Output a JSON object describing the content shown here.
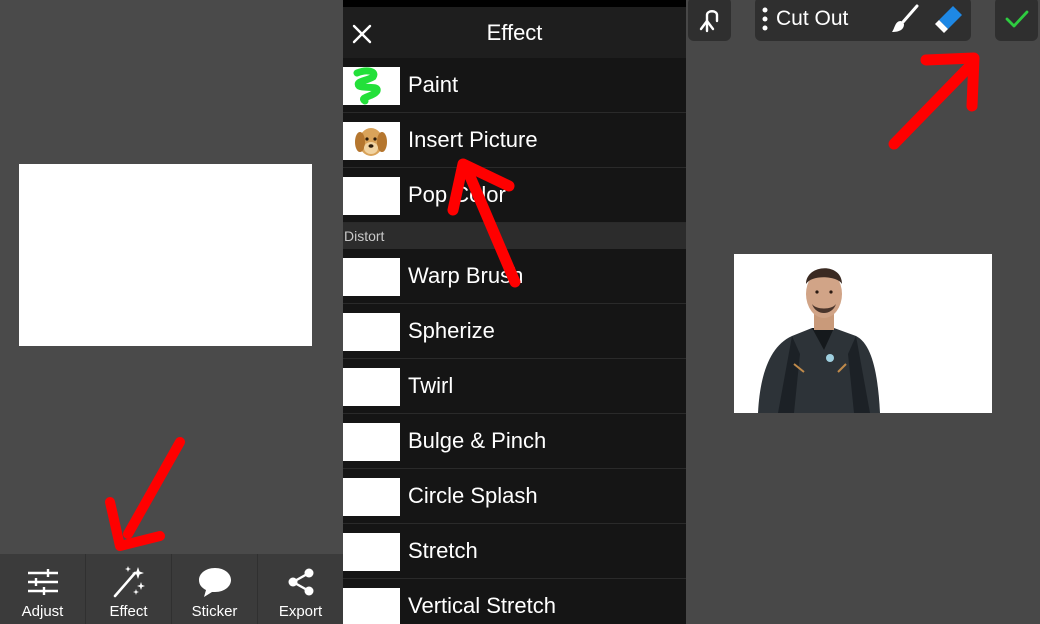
{
  "panel1": {
    "toolbar": [
      {
        "label": "Adjust",
        "icon": "sliders-icon"
      },
      {
        "label": "Effect",
        "icon": "magic-wand-icon"
      },
      {
        "label": "Sticker",
        "icon": "speech-bubble-icon"
      },
      {
        "label": "Export",
        "icon": "share-icon"
      }
    ]
  },
  "panel2": {
    "title": "Effect",
    "close_icon": "close-icon",
    "items_top": [
      {
        "label": "Paint",
        "thumb": "green-paint-stroke"
      },
      {
        "label": "Insert Picture",
        "thumb": "dog-photo"
      },
      {
        "label": "Pop Color",
        "thumb": "blank"
      }
    ],
    "section": "Distort",
    "items_distort": [
      {
        "label": "Warp Brush"
      },
      {
        "label": "Spherize"
      },
      {
        "label": "Twirl"
      },
      {
        "label": "Bulge & Pinch"
      },
      {
        "label": "Circle Splash"
      },
      {
        "label": "Stretch"
      },
      {
        "label": "Vertical Stretch"
      }
    ]
  },
  "panel3": {
    "tool_label": "Cut Out",
    "undo_icon": "undo-icon",
    "brush_icon": "brush-icon",
    "eraser_icon": "eraser-icon",
    "confirm_icon": "checkmark-icon"
  },
  "colors": {
    "annotation_arrow": "#ff0000",
    "confirm_check": "#2ecc40",
    "eraser_blue": "#1e88e5"
  }
}
